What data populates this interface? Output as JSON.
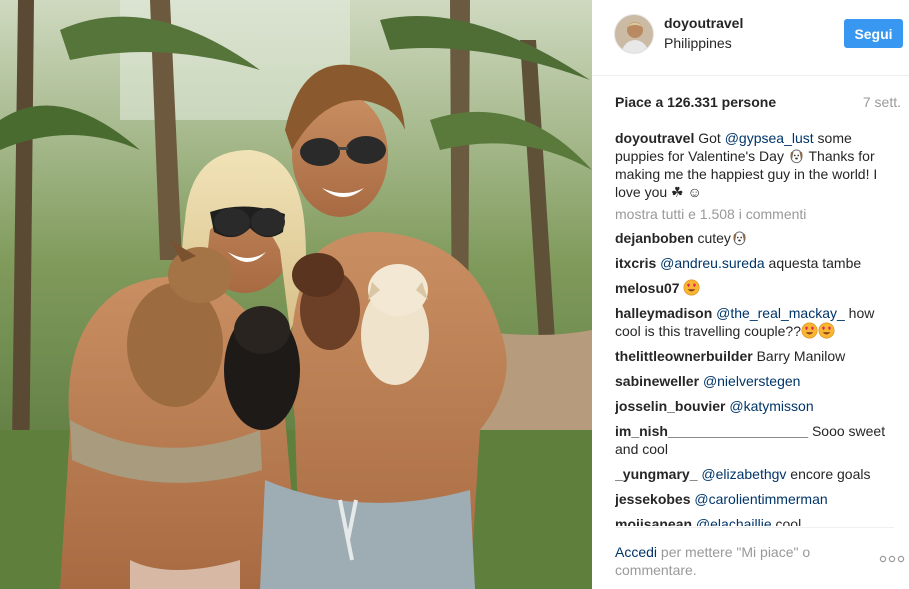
{
  "post": {
    "image_description_icon": "photo",
    "author": "doyoutravel",
    "location": "Philippines",
    "follow_label": "Segui",
    "likes_text": "Piace a 126.331 persone",
    "age": "7 sett.",
    "caption": {
      "user": "doyoutravel",
      "parts": [
        {
          "t": "text",
          "v": " Got "
        },
        {
          "t": "mention",
          "v": "@gypsea_lust"
        },
        {
          "t": "text",
          "v": " some puppies for Valentine's Day "
        },
        {
          "t": "emoji",
          "v": "dog-face-emoji"
        },
        {
          "t": "text",
          "v": " Thanks for making me the happiest guy in the world! I love you ☘ ☺"
        }
      ]
    },
    "show_all_label": "mostra tutti e 1.508 i commenti",
    "comments": [
      {
        "user": "dejanboben",
        "parts": [
          {
            "t": "text",
            "v": " cutey"
          },
          {
            "t": "emoji",
            "v": "dog-face-emoji"
          }
        ]
      },
      {
        "user": "itxcris",
        "parts": [
          {
            "t": "text",
            "v": " "
          },
          {
            "t": "mention",
            "v": "@andreu.sureda"
          },
          {
            "t": "text",
            "v": " aquesta tambe"
          }
        ]
      },
      {
        "user": "melosu07",
        "parts": [
          {
            "t": "text",
            "v": " "
          },
          {
            "t": "emoji",
            "v": "heart-eyes-emoji"
          }
        ]
      },
      {
        "user": "halleymadison",
        "parts": [
          {
            "t": "text",
            "v": " "
          },
          {
            "t": "mention",
            "v": "@the_real_mackay_"
          },
          {
            "t": "text",
            "v": " how cool is this travelling couple??"
          },
          {
            "t": "emoji",
            "v": "heart-eyes-emoji"
          },
          {
            "t": "emoji",
            "v": "heart-eyes-emoji"
          }
        ]
      },
      {
        "user": "thelittleownerbuilder",
        "parts": [
          {
            "t": "text",
            "v": " Barry Manilow"
          }
        ]
      },
      {
        "user": "sabineweller",
        "parts": [
          {
            "t": "text",
            "v": " "
          },
          {
            "t": "mention",
            "v": "@nielverstegen"
          }
        ]
      },
      {
        "user": "josselin_bouvier",
        "parts": [
          {
            "t": "text",
            "v": " "
          },
          {
            "t": "mention",
            "v": "@katymisson"
          }
        ]
      },
      {
        "user": "im_nish__________________",
        "parts": [
          {
            "t": "text",
            "v": " Sooo sweet and cool"
          }
        ]
      },
      {
        "user": "_yungmary_",
        "parts": [
          {
            "t": "text",
            "v": " "
          },
          {
            "t": "mention",
            "v": "@elizabethgv"
          },
          {
            "t": "text",
            "v": " encore goals"
          }
        ]
      },
      {
        "user": "jessekobes",
        "parts": [
          {
            "t": "text",
            "v": " "
          },
          {
            "t": "mention",
            "v": "@carolientimmerman"
          }
        ]
      },
      {
        "user": "mojisanean",
        "parts": [
          {
            "t": "text",
            "v": " "
          },
          {
            "t": "mention",
            "v": "@elachaillie"
          },
          {
            "t": "text",
            "v": " cool"
          }
        ]
      }
    ],
    "footer": {
      "login_label": "Accedi",
      "rest": " per mettere \"Mi piace\" o commentare."
    },
    "more_icon": "ellipsis-icon"
  },
  "colors": {
    "accent": "#3897f0",
    "mention": "#003569",
    "muted": "#999999",
    "text": "#262626"
  }
}
